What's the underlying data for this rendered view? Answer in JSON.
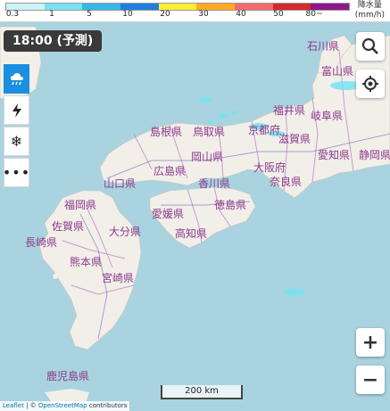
{
  "legend": {
    "colors": [
      "#cdf3f8",
      "#78e3f0",
      "#36b7e6",
      "#1e7fe0",
      "#ffee33",
      "#ffaa22",
      "#f36a6a",
      "#d42a2a",
      "#8b1a8b"
    ],
    "ticks": [
      "0.3",
      "1",
      "5",
      "10",
      "20",
      "30",
      "40",
      "50",
      "80~"
    ],
    "unit_title": "降水量",
    "unit": "(mm/h)"
  },
  "time_label": "18:00 (予測)",
  "side_buttons": [
    {
      "icon": "rain-cloud-icon",
      "active": true
    },
    {
      "icon": "lightning-icon",
      "active": false
    },
    {
      "icon": "snowflake-icon",
      "active": false
    },
    {
      "icon": "more-icon",
      "active": false
    }
  ],
  "prefectures": [
    "石川県",
    "富山県",
    "福井県",
    "岐阜県",
    "滋賀県",
    "愛知県",
    "静岡県",
    "京都府",
    "鳥取県",
    "島根県",
    "岡山県",
    "広島県",
    "大阪府",
    "奈良県",
    "香川県",
    "山口県",
    "徳島県",
    "愛媛県",
    "高知県",
    "福岡県",
    "佐賀県",
    "大分県",
    "長崎県",
    "熊本県",
    "宮崎県",
    "鹿児島県"
  ],
  "scale_label": "200 km",
  "attribution": {
    "leaflet": "Leaflet",
    "sep": " | © ",
    "osm": "OpenStreetMap",
    "contrib": " contributors"
  }
}
